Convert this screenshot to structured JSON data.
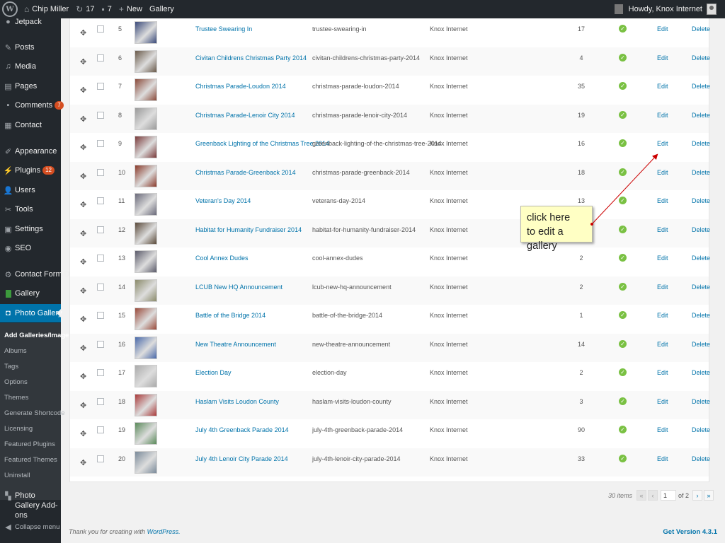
{
  "adminbar": {
    "site_name": "Chip Miller",
    "updates_count": "17",
    "comments_count": "7",
    "new_label": "New",
    "gallery_label": "Gallery",
    "howdy": "Howdy, Knox Internet"
  },
  "sidebar": {
    "jetpack": "Jetpack",
    "posts": "Posts",
    "media": "Media",
    "pages": "Pages",
    "comments": "Comments",
    "comments_badge": "7",
    "contact": "Contact",
    "appearance": "Appearance",
    "plugins": "Plugins",
    "plugins_badge": "12",
    "users": "Users",
    "tools": "Tools",
    "settings": "Settings",
    "seo": "SEO",
    "contact_form_db": "Contact Form DB",
    "gallery": "Gallery",
    "photo_gallery": "Photo Gallery",
    "submenu": [
      "Add Galleries/Images",
      "Albums",
      "Tags",
      "Options",
      "Themes",
      "Generate Shortcode",
      "Licensing",
      "Featured Plugins",
      "Featured Themes",
      "Uninstall"
    ],
    "photo_gallery_addons": "Photo Gallery Add-ons",
    "collapse": "Collapse menu"
  },
  "rows": [
    {
      "num": "5",
      "title": "Trustee Swearing In",
      "slug": "trustee-swearing-in",
      "author": "Knox Internet",
      "count": "17",
      "thumb": "#3a4a7a"
    },
    {
      "num": "6",
      "title": "Civitan Childrens Christmas Party 2014",
      "slug": "civitan-childrens-christmas-party-2014",
      "author": "Knox Internet",
      "count": "4",
      "thumb": "#6a5a4a"
    },
    {
      "num": "7",
      "title": "Christmas Parade-Loudon 2014",
      "slug": "christmas-parade-loudon-2014",
      "author": "Knox Internet",
      "count": "35",
      "thumb": "#8a4a3a"
    },
    {
      "num": "8",
      "title": "Christmas Parade-Lenoir City 2014",
      "slug": "christmas-parade-lenoir-city-2014",
      "author": "Knox Internet",
      "count": "19",
      "thumb": "#9a9a9a"
    },
    {
      "num": "9",
      "title": "Greenback Lighting of the Christmas Tree 2014",
      "slug": "greenback-lighting-of-the-christmas-tree-2014",
      "author": "Knox Internet",
      "count": "16",
      "thumb": "#7a3a3a"
    },
    {
      "num": "10",
      "title": "Christmas Parade-Greenback 2014",
      "slug": "christmas-parade-greenback-2014",
      "author": "Knox Internet",
      "count": "18",
      "thumb": "#8a3a2a"
    },
    {
      "num": "11",
      "title": "Veteran's Day 2014",
      "slug": "veterans-day-2014",
      "author": "Knox Internet",
      "count": "13",
      "thumb": "#6a6a7a"
    },
    {
      "num": "12",
      "title": "Habitat for Humanity Fundraiser 2014",
      "slug": "habitat-for-humanity-fundraiser-2014",
      "author": "Knox Internet",
      "count": "",
      "thumb": "#5a4a3a"
    },
    {
      "num": "13",
      "title": "Cool Annex Dudes",
      "slug": "cool-annex-dudes",
      "author": "Knox Internet",
      "count": "2",
      "thumb": "#5a5a6a"
    },
    {
      "num": "14",
      "title": "LCUB New HQ Announcement",
      "slug": "lcub-new-hq-announcement",
      "author": "Knox Internet",
      "count": "2",
      "thumb": "#8a8a6a"
    },
    {
      "num": "15",
      "title": "Battle of the Bridge 2014",
      "slug": "battle-of-the-bridge-2014",
      "author": "Knox Internet",
      "count": "1",
      "thumb": "#9a4a3a"
    },
    {
      "num": "16",
      "title": "New Theatre Announcement",
      "slug": "new-theatre-announcement",
      "author": "Knox Internet",
      "count": "14",
      "thumb": "#4a6aaa"
    },
    {
      "num": "17",
      "title": "Election Day",
      "slug": "election-day",
      "author": "Knox Internet",
      "count": "2",
      "thumb": "#aaaaaa"
    },
    {
      "num": "18",
      "title": "Haslam Visits Loudon County",
      "slug": "haslam-visits-loudon-county",
      "author": "Knox Internet",
      "count": "3",
      "thumb": "#aa3a3a"
    },
    {
      "num": "19",
      "title": "July 4th Greenback Parade 2014",
      "slug": "july-4th-greenback-parade-2014",
      "author": "Knox Internet",
      "count": "90",
      "thumb": "#5a8a5a"
    },
    {
      "num": "20",
      "title": "July 4th Lenoir City Parade 2014",
      "slug": "july-4th-lenoir-city-parade-2014",
      "author": "Knox Internet",
      "count": "33",
      "thumb": "#7a8a9a"
    }
  ],
  "row_actions": {
    "edit": "Edit",
    "delete": "Delete"
  },
  "pagination": {
    "items": "30 items",
    "first": "«",
    "prev": "‹",
    "current_page": "1",
    "of": "of 2",
    "next": "›",
    "last": "»"
  },
  "footer": {
    "thank_you": "Thank you for creating with",
    "wordpress": "WordPress.",
    "version": "Get Version 4.3.1"
  },
  "callout": {
    "line1": "click here",
    "line2": "to edit a gallery"
  },
  "colors": {
    "adminbar": "#23282d",
    "accent": "#0073aa",
    "published": "#7ac143",
    "badge": "#d54e21",
    "callout": "#ffffc4"
  }
}
